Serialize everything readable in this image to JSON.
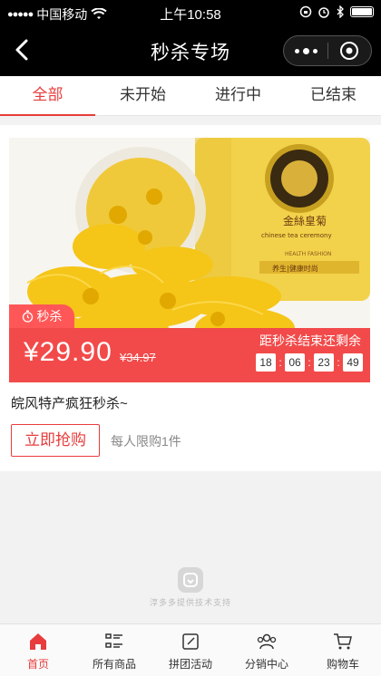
{
  "status_bar": {
    "carrier": "中国移动",
    "time": "上午10:58"
  },
  "header": {
    "title": "秒杀专场"
  },
  "tabs": [
    {
      "label": "全部",
      "active": true
    },
    {
      "label": "未开始",
      "active": false
    },
    {
      "label": "进行中",
      "active": false
    },
    {
      "label": "已结束",
      "active": false
    }
  ],
  "product": {
    "badge": "秒杀",
    "price": "¥29.90",
    "original_price": "¥34.97",
    "countdown_label": "距秒杀结束还剩余",
    "countdown": {
      "days": "18",
      "hours": "06",
      "minutes": "23",
      "seconds": "49"
    },
    "name": "皖风特产疯狂秒杀~",
    "buy_label": "立即抢购",
    "limit": "每人限购1件",
    "package_text": "金絲皇菊",
    "package_sub": "chinese tea ceremony",
    "package_small": "HEALTH FASHION",
    "package_tag": "养生|健康时尚"
  },
  "footer": {
    "brand_text": "淳多多提供技术支持"
  },
  "bottom_nav": [
    {
      "label": "首页",
      "icon": "home-icon",
      "active": true
    },
    {
      "label": "所有商品",
      "icon": "list-icon",
      "active": false
    },
    {
      "label": "拼团活动",
      "icon": "edit-icon",
      "active": false
    },
    {
      "label": "分销中心",
      "icon": "people-icon",
      "active": false
    },
    {
      "label": "购物车",
      "icon": "cart-icon",
      "active": false
    }
  ],
  "colors": {
    "accent": "#e83c3c",
    "price_bar": "#f24a4a",
    "badge": "#ff5757"
  }
}
